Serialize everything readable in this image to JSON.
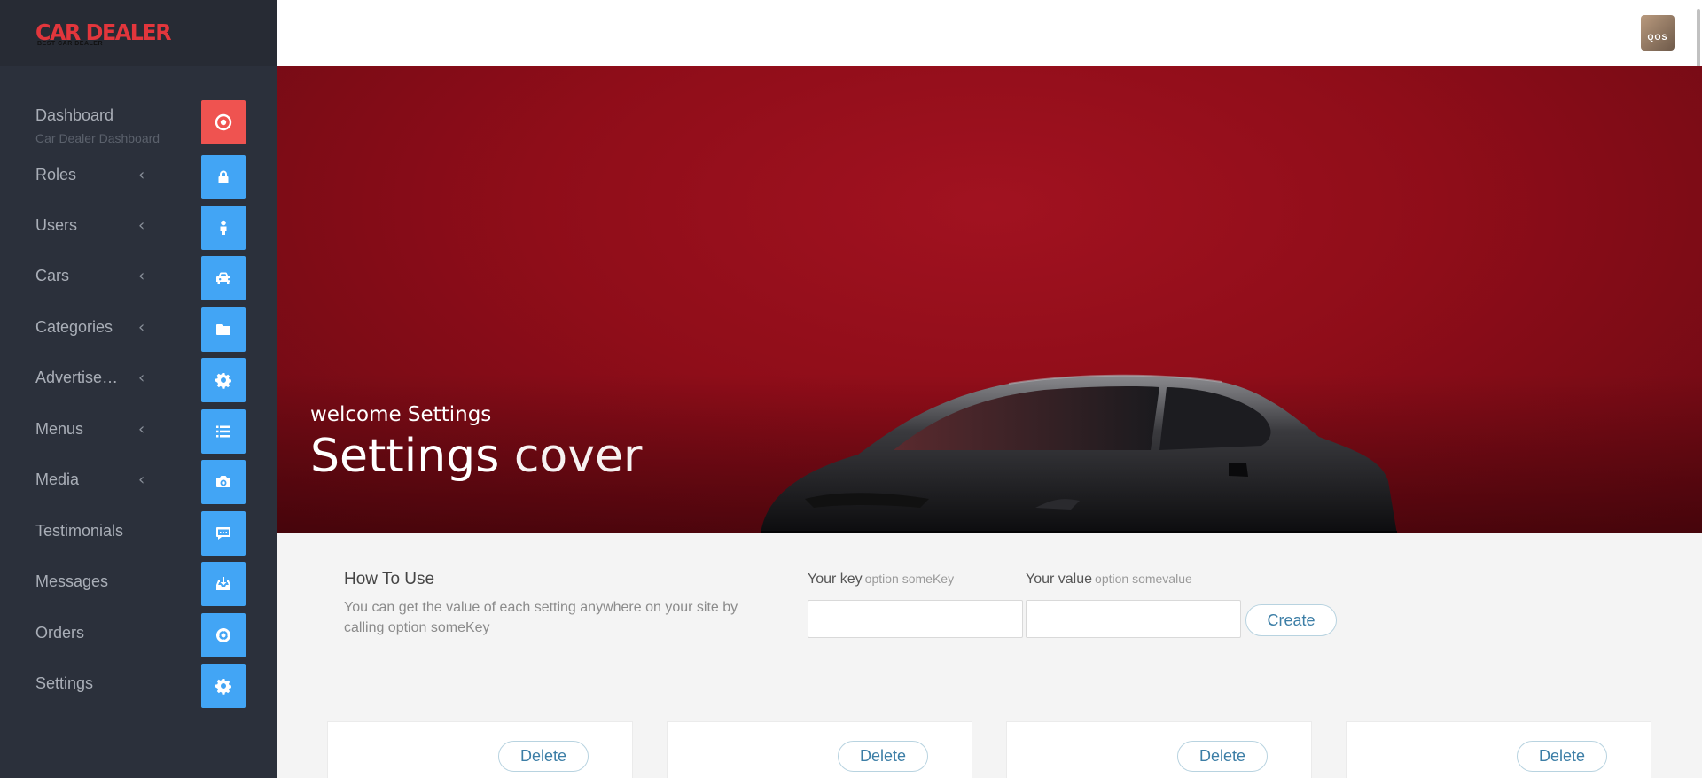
{
  "brand": {
    "name": "CAR DEALER",
    "tagline": "BEST CAR DEALER"
  },
  "sidebar": {
    "items": [
      {
        "label": "Dashboard",
        "sub": "Car Dealer Dashboard",
        "icon": "target-icon",
        "has_submenu": false,
        "active": true
      },
      {
        "label": "Roles",
        "icon": "lock-icon",
        "has_submenu": true
      },
      {
        "label": "Users",
        "icon": "user-icon",
        "has_submenu": true
      },
      {
        "label": "Cars",
        "icon": "car-icon",
        "has_submenu": true
      },
      {
        "label": "Categories",
        "icon": "folder-icon",
        "has_submenu": true
      },
      {
        "label": "Advertise…",
        "icon": "gear-icon",
        "has_submenu": true
      },
      {
        "label": "Menus",
        "icon": "list-icon",
        "has_submenu": true
      },
      {
        "label": "Media",
        "icon": "camera-icon",
        "has_submenu": true
      },
      {
        "label": "Testimonials",
        "icon": "comment-icon",
        "has_submenu": false
      },
      {
        "label": "Messages",
        "icon": "inbox-icon",
        "has_submenu": false
      },
      {
        "label": "Orders",
        "icon": "life-ring-icon",
        "has_submenu": false
      },
      {
        "label": "Settings",
        "icon": "gear-icon",
        "has_submenu": false
      }
    ],
    "chevron": "‹"
  },
  "topbar": {
    "avatar_text": "QOS"
  },
  "hero": {
    "welcome": "welcome Settings",
    "title_bold": "Settings",
    "title_light": "cover"
  },
  "how_to_use": {
    "title": "How To Use",
    "text": "You can get the value of each setting anywhere on your site by calling option someKey"
  },
  "form": {
    "key_label": "Your key",
    "key_hint": "option someKey",
    "key_value": "",
    "value_label": "Your value",
    "value_hint": "option somevalue",
    "value_value": "",
    "create_label": "Create"
  },
  "cards": [
    {
      "delete_label": "Delete"
    },
    {
      "delete_label": "Delete"
    },
    {
      "delete_label": "Delete"
    },
    {
      "delete_label": "Delete"
    }
  ],
  "colors": {
    "sidebar_bg": "#2b303b",
    "icon_blue": "#42a5f5",
    "icon_active": "#ef5350",
    "hero_red": "#8f0d19",
    "brand_red": "#e2363c"
  }
}
